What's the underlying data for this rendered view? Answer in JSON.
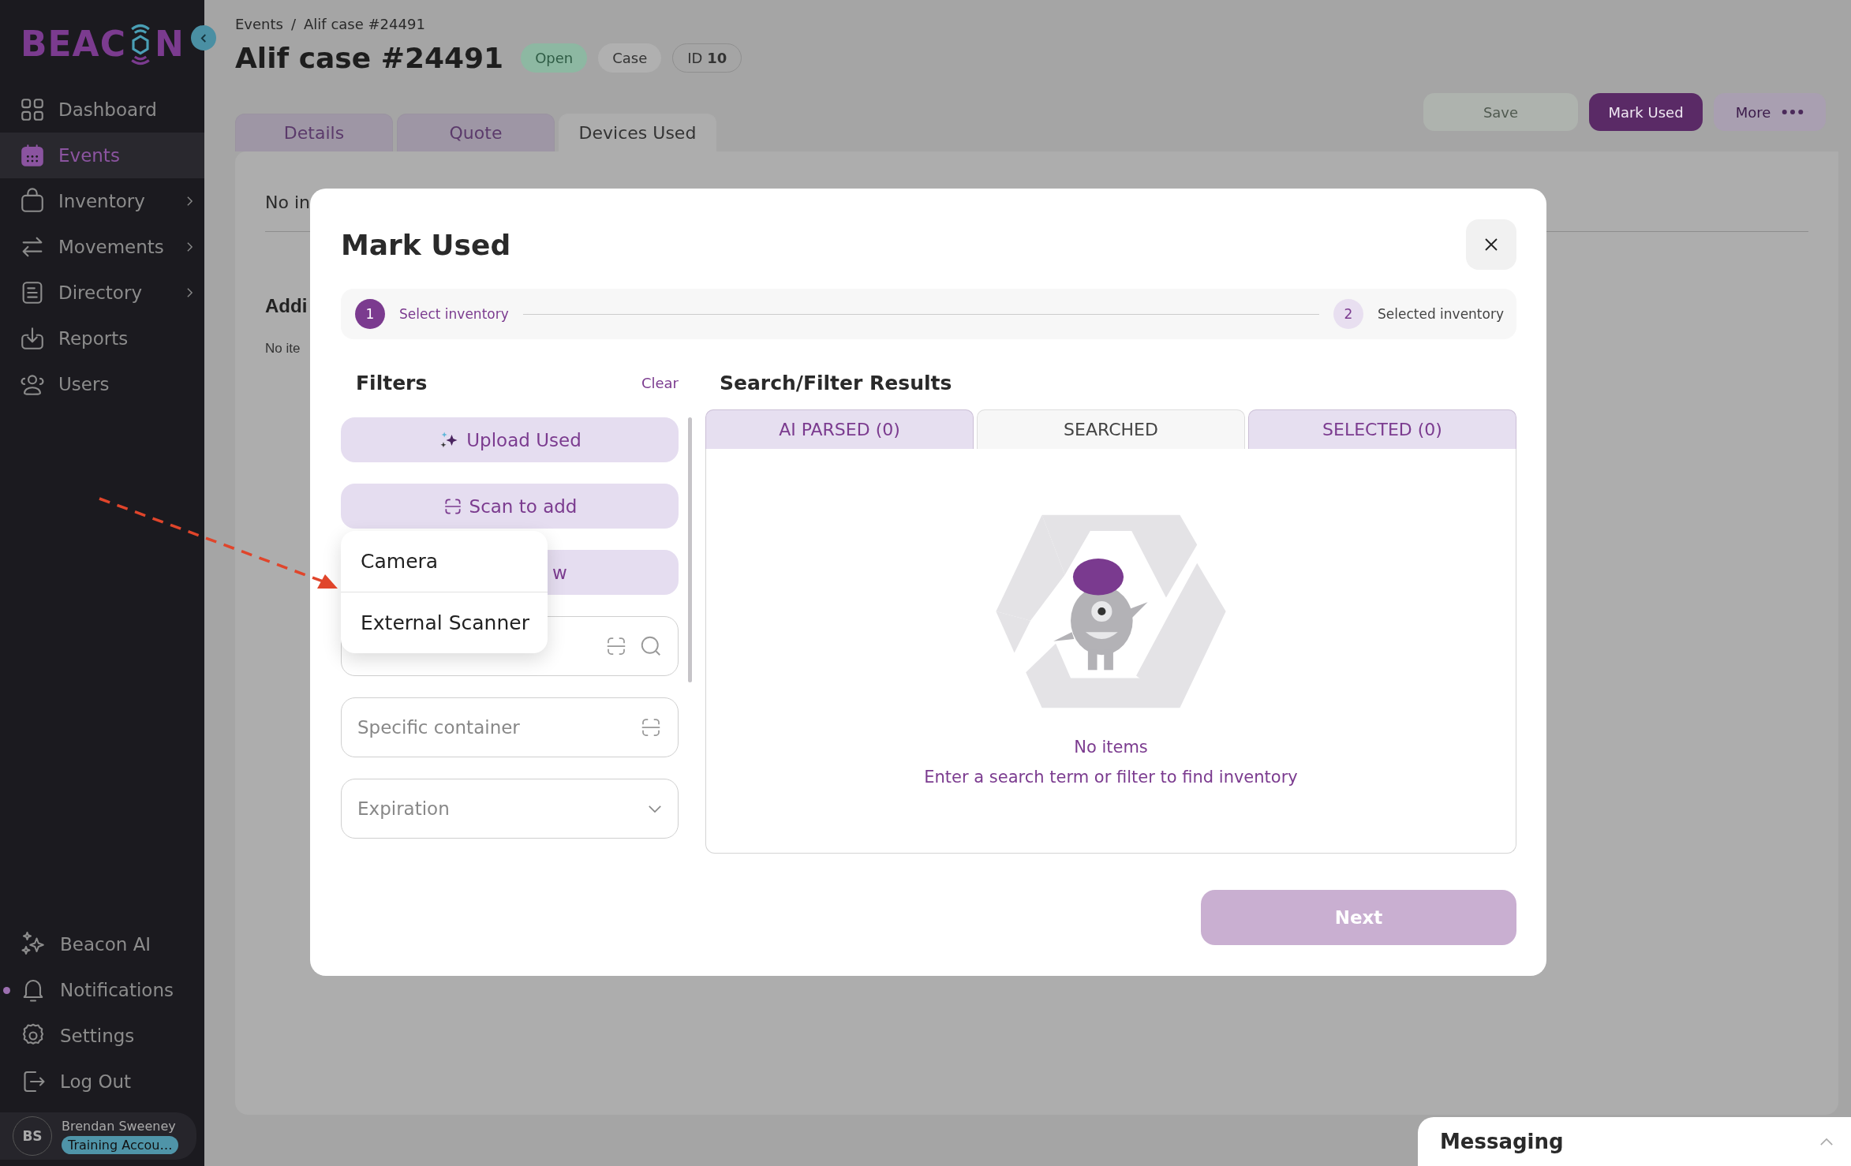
{
  "sidebar": {
    "logo": {
      "before": "BEAC",
      "after": "N"
    },
    "nav": [
      {
        "label": "Dashboard",
        "selected": false,
        "submenu": false
      },
      {
        "label": "Events",
        "selected": true,
        "submenu": false
      },
      {
        "label": "Inventory",
        "selected": false,
        "submenu": true
      },
      {
        "label": "Movements",
        "selected": false,
        "submenu": true
      },
      {
        "label": "Directory",
        "selected": false,
        "submenu": true
      },
      {
        "label": "Reports",
        "selected": false,
        "submenu": false
      },
      {
        "label": "Users",
        "selected": false,
        "submenu": false
      }
    ],
    "bottom_nav": [
      {
        "label": "Beacon AI",
        "unread": false
      },
      {
        "label": "Notifications",
        "unread": true
      },
      {
        "label": "Settings",
        "unread": false
      },
      {
        "label": "Log Out",
        "unread": false
      }
    ],
    "user": {
      "initials": "BS",
      "name": "Brendan Sweeney",
      "badge": "Training Accou…"
    }
  },
  "page": {
    "breadcrumb": [
      "Events",
      "Alif case #24491"
    ],
    "breadcrumb_separator": "/",
    "title": "Alif case #24491",
    "badges": [
      {
        "label": "Open",
        "kind": "status"
      },
      {
        "label": "Case",
        "kind": "type"
      },
      {
        "label": "ID **10**",
        "kind": "id"
      }
    ],
    "tabs": [
      {
        "label": "Details",
        "selected": false
      },
      {
        "label": "Quote",
        "selected": false
      },
      {
        "label": "Devices Used",
        "selected": true
      }
    ],
    "actions": [
      {
        "label": "Save",
        "kind": "save",
        "disabled": true
      },
      {
        "label": "Mark Used",
        "kind": "primary",
        "disabled": false
      },
      {
        "label": "More",
        "kind": "more",
        "disabled": false
      }
    ],
    "content": {
      "line_1": "No in",
      "heading": "Addi",
      "line_2": "No ite"
    }
  },
  "modal": {
    "title": "Mark Used",
    "steps": [
      {
        "number": "1",
        "label": "Select inventory",
        "selected": true
      },
      {
        "number": "2",
        "label": "Selected inventory",
        "selected": false
      }
    ],
    "filters": {
      "title": "Filters",
      "clear": "Clear",
      "buttons": [
        {
          "label": "Upload Used"
        },
        {
          "label": "Scan to add"
        },
        {
          "label": "w"
        }
      ],
      "fields": [
        {
          "kind": "search"
        },
        {
          "kind": "scan",
          "placeholder": "Specific container"
        },
        {
          "kind": "select",
          "placeholder": "Expiration"
        }
      ],
      "menu": [
        {
          "label": "Camera"
        },
        {
          "label": "External Scanner"
        }
      ]
    },
    "results": {
      "title": "Search/Filter Results",
      "tabs": [
        {
          "label": "AI PARSED (0)",
          "selected": false
        },
        {
          "label": "SEARCHED",
          "selected": true
        },
        {
          "label": "SELECTED (0)",
          "selected": false
        }
      ],
      "empty_title": "No items",
      "empty_message": "Enter a search term or filter to find inventory"
    },
    "next": {
      "label": "Next",
      "disabled": true
    }
  },
  "messaging": {
    "title": "Messaging",
    "expanded": false
  }
}
